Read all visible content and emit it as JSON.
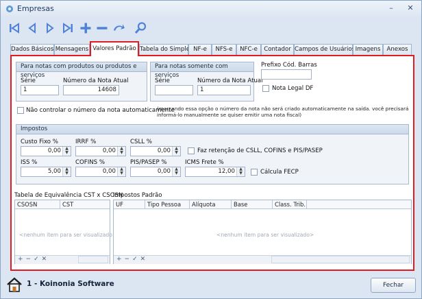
{
  "window": {
    "title": "Empresas",
    "minimize": "–",
    "close": "✕"
  },
  "tabs": [
    {
      "label": "Dados Básicos"
    },
    {
      "label": "Mensagens"
    },
    {
      "label": "Valores Padrão"
    },
    {
      "label": "Tabela do Simples"
    },
    {
      "label": "NF-e"
    },
    {
      "label": "NFS-e"
    },
    {
      "label": "NFC-e"
    },
    {
      "label": "Contador"
    },
    {
      "label": "Campos de Usuários"
    },
    {
      "label": "Imagens"
    },
    {
      "label": "Anexos"
    }
  ],
  "produtos": {
    "title": "Para notas com produtos ou produtos e serviços",
    "serie_label": "Série",
    "serie_value": "1",
    "nota_label": "Número da Nota Atual",
    "nota_value": "14608"
  },
  "servicos": {
    "title": "Para notas somente com serviços",
    "serie_label": "Série",
    "serie_value": "",
    "nota_label": "Número da Nota Atual",
    "nota_value": "1"
  },
  "prefixo": {
    "label": "Prefixo Cód. Barras",
    "value": ""
  },
  "nota_legal": {
    "label": "Nota Legal DF",
    "checked": false
  },
  "nao_controlar": {
    "label": "Não controlar o número da nota automaticamente",
    "note": "(marcando essa opção o número da nota não será criado automaticamente na saída. você precisará informá-lo manualmente se quiser emitir uma nota fiscal)"
  },
  "impostos": {
    "title": "Impostos",
    "custo_fixo_label": "Custo Fixo %",
    "custo_fixo_value": "0,00",
    "irrf_label": "IRRF %",
    "irrf_value": "0,00",
    "csll_label": "CSLL %",
    "csll_value": "0,00",
    "retencao_label": "Faz retenção de CSLL, COFINS e PIS/PASEP",
    "iss_label": "ISS %",
    "iss_value": "5,00",
    "cofins_label": "COFINS %",
    "cofins_value": "0,00",
    "pis_label": "PIS/PASEP %",
    "pis_value": "0,00",
    "icms_label": "ICMS Frete %",
    "icms_value": "12,00",
    "fecp_label": "Cálcula FECP"
  },
  "cst_table": {
    "title": "Tabela de Equivalência CST x CSOSN",
    "columns": [
      "CSOSN",
      "CST"
    ],
    "empty": "<nenhum item para ser visualizado>"
  },
  "impostos_padrao": {
    "title": "Impostos Padrão",
    "columns": [
      "UF",
      "Tipo Pessoa",
      "Alíquota",
      "Base",
      "Class. Trib."
    ],
    "empty": "<nenhum item para ser visualizado>"
  },
  "footer": {
    "company": "1 - Koinonia Software",
    "close_button": "Fechar"
  },
  "colors": {
    "highlight": "#e01b22",
    "toolbar_icon": "#4f82d8"
  }
}
